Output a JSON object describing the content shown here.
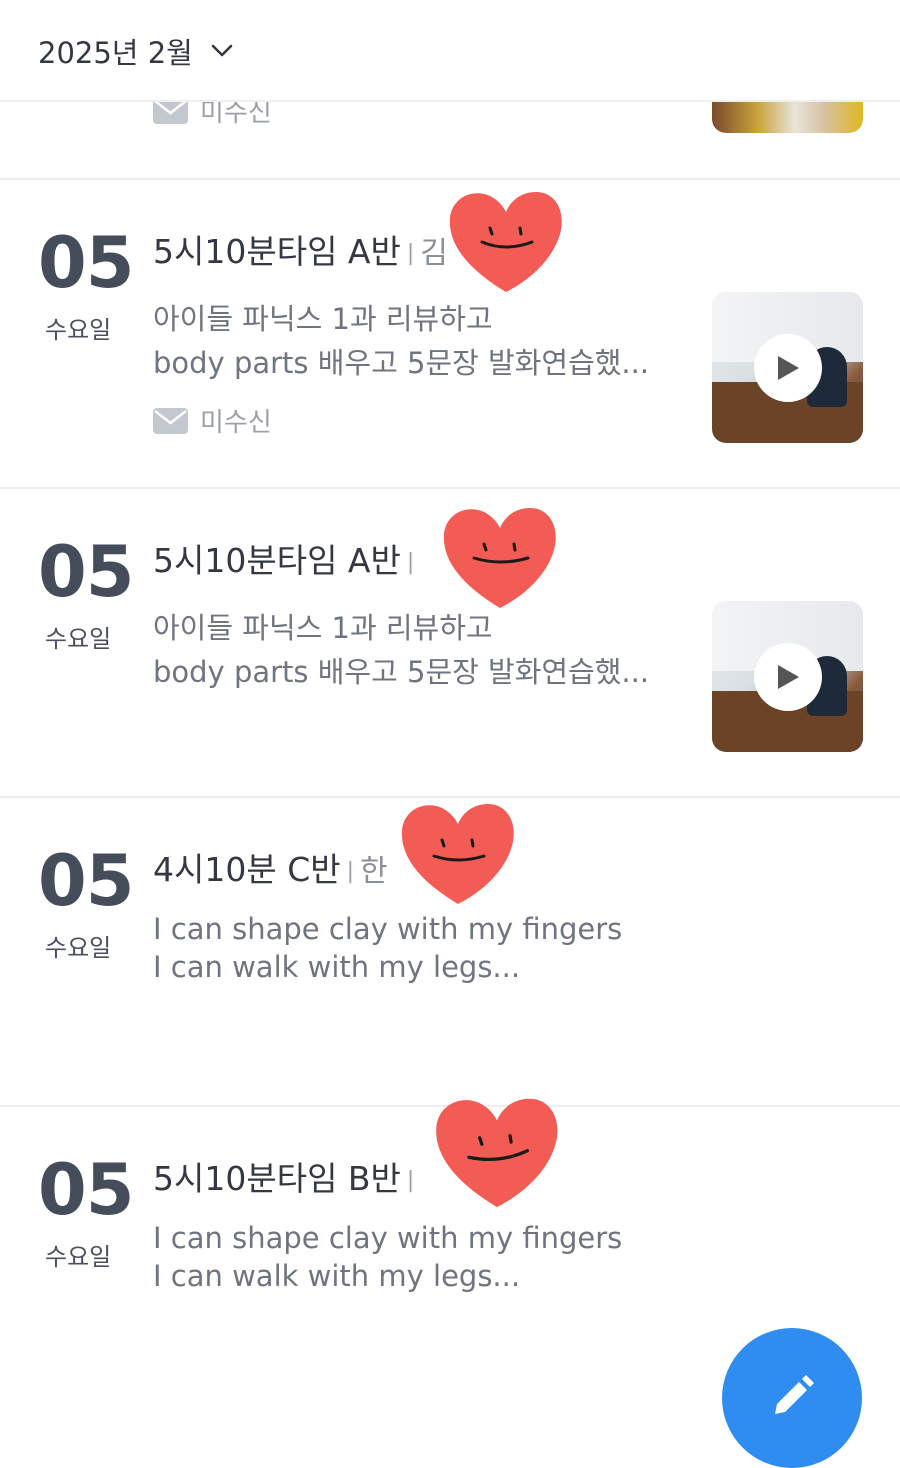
{
  "header": {
    "month_label": "2025년 2월"
  },
  "top_partial": {
    "unread_label": "미수신"
  },
  "cards": [
    {
      "day": "05",
      "weekday": "수요일",
      "class_name": "5시10분타임 A반",
      "teacher_visible": "김",
      "lines": [
        "아이들 파닉스 1과 리뷰하고",
        "body parts 배우고 5문장 발화연습했..."
      ],
      "unread_label": "미수신"
    },
    {
      "day": "05",
      "weekday": "수요일",
      "class_name": "5시10분타임 A반",
      "teacher_visible": "",
      "lines": [
        "아이들 파닉스 1과 리뷰하고",
        "body parts 배우고 5문장 발화연습했..."
      ]
    },
    {
      "day": "05",
      "weekday": "수요일",
      "class_name": "4시10분 C반",
      "teacher_visible": "한",
      "lines": [
        "I can shape clay with my fingers",
        "I can walk with my legs..."
      ]
    },
    {
      "day": "05",
      "weekday": "수요일",
      "class_name": "5시10분타임 B반",
      "teacher_visible": "",
      "lines": [
        "I can shape clay with my fingers",
        "I can walk with my legs..."
      ]
    }
  ],
  "colors": {
    "fab": "#2f8cf0",
    "heart": "#f25c54",
    "separator": "#eceef1"
  },
  "icons": {
    "month": "chevron-down-icon",
    "unread": "envelope-icon",
    "video": "play-icon",
    "fab": "pencil-icon",
    "sticker": "smiling-heart-sticker"
  }
}
